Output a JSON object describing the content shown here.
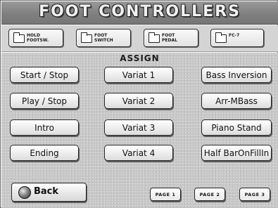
{
  "window": {
    "title": "FOOT CONTROLLERS"
  },
  "tabs": [
    {
      "label": "HOLD\nFOOTSW.",
      "icon": "folder-icon"
    },
    {
      "label": "FOOT\nSWITCH",
      "icon": "folder-icon"
    },
    {
      "label": "FOOT\nPEDAL",
      "icon": "folder-icon"
    },
    {
      "label": "FC-7",
      "icon": "folder-icon"
    }
  ],
  "assign": {
    "section_label": "ASSIGN",
    "column1": [
      "Start / Stop",
      "Play / Stop",
      "Intro",
      "Ending"
    ],
    "column2": [
      "Variat 1",
      "Variat 2",
      "Variat 3",
      "Variat 4"
    ],
    "column3": [
      "Bass Inversion",
      "Arr-MBass",
      "Piano Stand",
      "Half BarOnFillIn"
    ]
  },
  "footer": {
    "back_label": "Back",
    "back_icon": "globe-icon",
    "pages": [
      "PAGE 1",
      "PAGE 2",
      "PAGE 3"
    ]
  }
}
